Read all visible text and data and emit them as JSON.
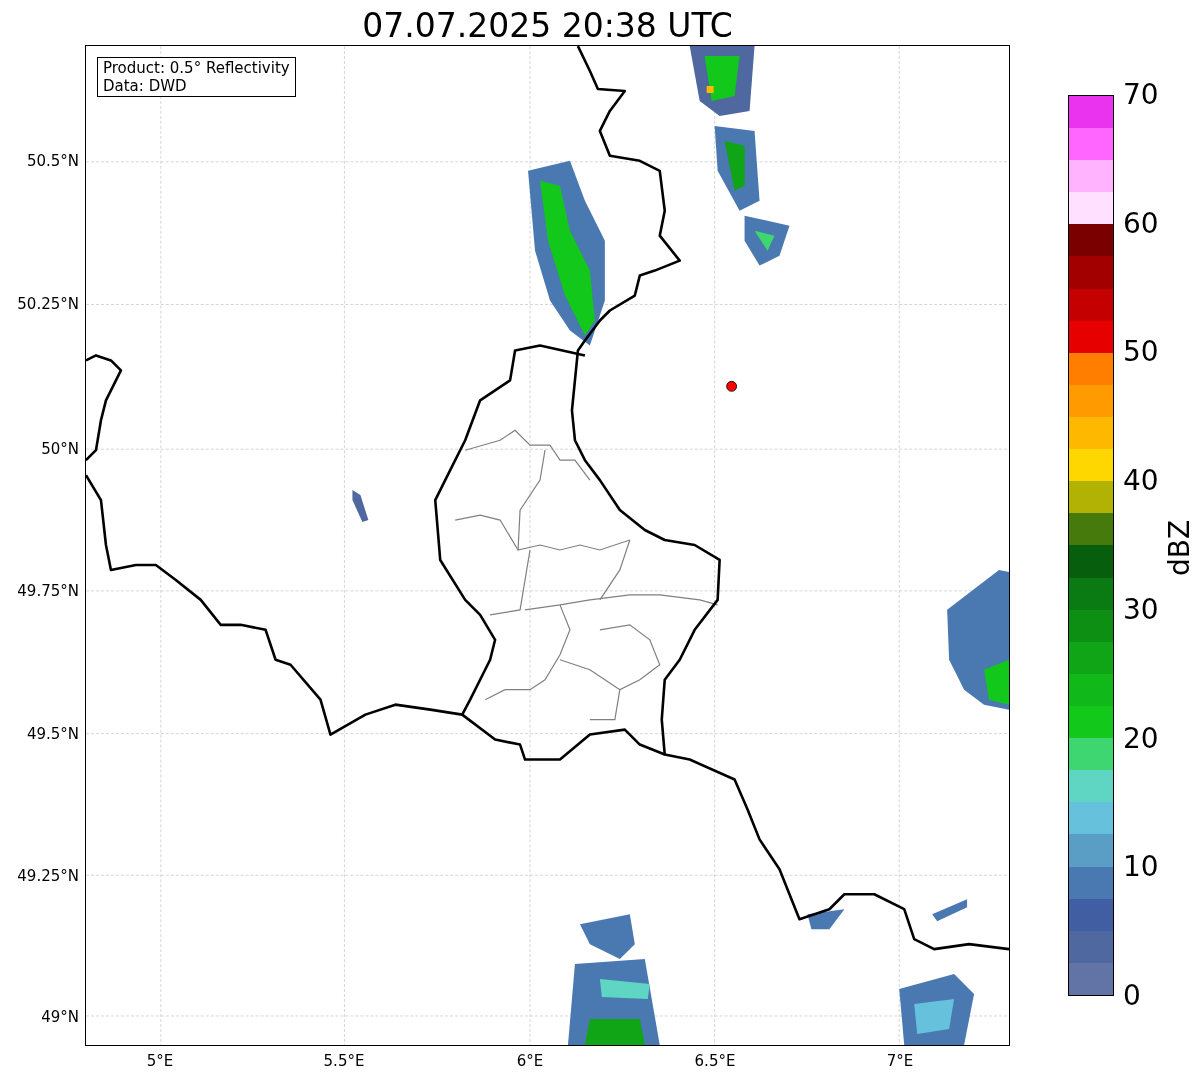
{
  "title": "07.07.2025 20:38 UTC",
  "info_box": [
    "Product: 0.5° Reflectivity",
    "Data: DWD"
  ],
  "x_ticks": [
    "5°E",
    "5.5°E",
    "6°E",
    "6.5°E",
    "7°E"
  ],
  "y_ticks": [
    "50.5°N",
    "50.25°N",
    "50°N",
    "49.75°N",
    "49.5°N",
    "49.25°N",
    "49°N"
  ],
  "colorbar": {
    "label": "dBZ",
    "ticks": [
      "70",
      "60",
      "50",
      "40",
      "30",
      "20",
      "10",
      "0"
    ],
    "bands": [
      {
        "color": "#6273a6"
      },
      {
        "color": "#4f68a0"
      },
      {
        "color": "#415ea2"
      },
      {
        "color": "#4a78b0"
      },
      {
        "color": "#5a9ec6"
      },
      {
        "color": "#66c2dc"
      },
      {
        "color": "#5fd6c4"
      },
      {
        "color": "#3dd670"
      },
      {
        "color": "#12c81b"
      },
      {
        "color": "#10b81a"
      },
      {
        "color": "#0fa517"
      },
      {
        "color": "#0d8f14"
      },
      {
        "color": "#0a7a12"
      },
      {
        "color": "#075e0c"
      },
      {
        "color": "#477a0c"
      },
      {
        "color": "#b2b204"
      },
      {
        "color": "#ffd700"
      },
      {
        "color": "#ffb800"
      },
      {
        "color": "#ff9a00"
      },
      {
        "color": "#ff7e00"
      },
      {
        "color": "#e60000"
      },
      {
        "color": "#c40000"
      },
      {
        "color": "#a20000"
      },
      {
        "color": "#7a0000"
      },
      {
        "color": "#ffe0ff"
      },
      {
        "color": "#ffb3ff"
      },
      {
        "color": "#ff66ff"
      },
      {
        "color": "#e933ee"
      }
    ]
  }
}
